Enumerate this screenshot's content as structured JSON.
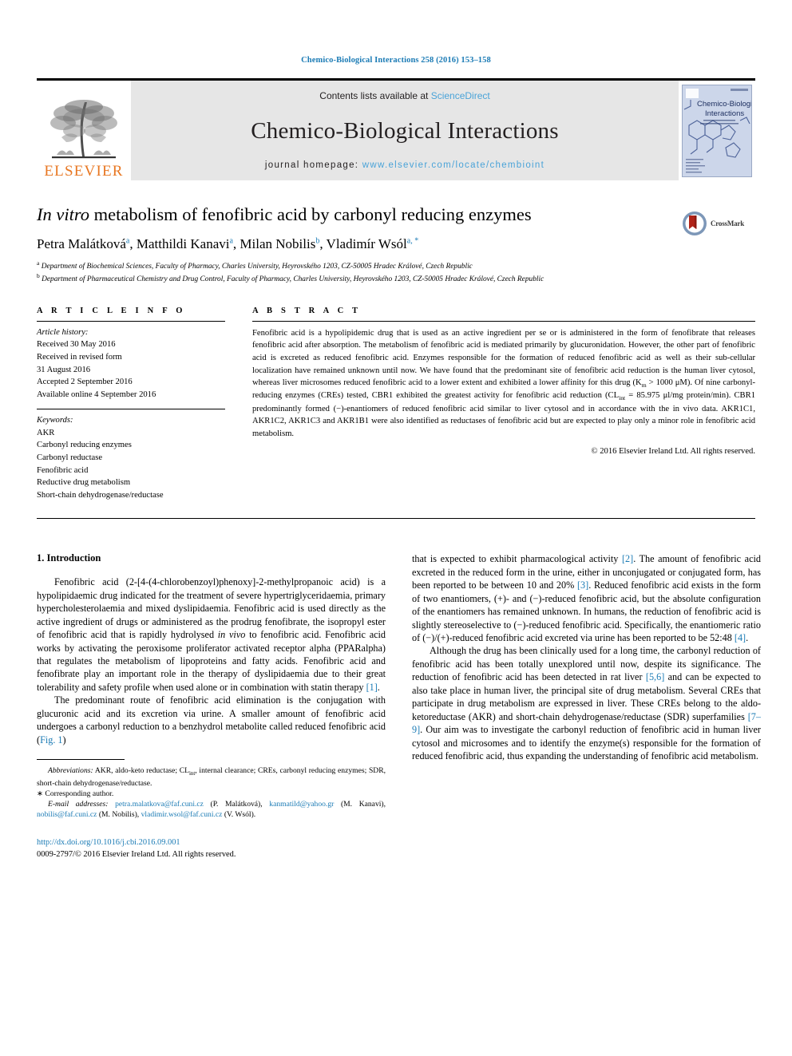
{
  "running_head": "Chemico-Biological Interactions 258 (2016) 153–158",
  "masthead": {
    "publisher_logo_name": "ELSEVIER",
    "contents_prefix": "Contents lists available at ",
    "contents_link": "ScienceDirect",
    "journal_title": "Chemico-Biological Interactions",
    "homepage_prefix": "journal homepage: ",
    "homepage_url": "www.elsevier.com/locate/chembioint",
    "cover_title_line1": "Chemico-Biological",
    "cover_title_line2": "Interactions"
  },
  "title": {
    "italic_lead": "In vitro",
    "rest": " metabolism of fenofibric acid by carbonyl reducing enzymes"
  },
  "crossmark": {
    "label": "CrossMark"
  },
  "authors": {
    "list": "Petra Malátková ᵃ, Matthildi Kanavi ᵃ, Milan Nobilis ᵇ, Vladimír Wsól ᵃ, *",
    "a1": "Petra Malátková",
    "a1_sup": "a",
    "a2": "Matthildi Kanavi",
    "a2_sup": "a",
    "a3": "Milan Nobilis",
    "a3_sup": "b",
    "a4": "Vladimír Wsól",
    "a4_sup": "a, *"
  },
  "affiliations": [
    {
      "marker": "a",
      "text": "Department of Biochemical Sciences, Faculty of Pharmacy, Charles University, Heyrovského 1203, CZ-50005 Hradec Králové, Czech Republic"
    },
    {
      "marker": "b",
      "text": "Department of Pharmaceutical Chemistry and Drug Control, Faculty of Pharmacy, Charles University, Heyrovského 1203, CZ-50005 Hradec Králové, Czech Republic"
    }
  ],
  "article_info": {
    "heading": "A R T I C L E   I N F O",
    "history_label": "Article history:",
    "history": [
      "Received 30 May 2016",
      "Received in revised form",
      "31 August 2016",
      "Accepted 2 September 2016",
      "Available online 4 September 2016"
    ],
    "keywords_label": "Keywords:",
    "keywords": [
      "AKR",
      "Carbonyl reducing enzymes",
      "Carbonyl reductase",
      "Fenofibric acid",
      "Reductive drug metabolism",
      "Short-chain dehydrogenase/reductase"
    ]
  },
  "abstract": {
    "heading": "A B S T R A C T",
    "text": "Fenofibric acid is a hypolipidemic drug that is used as an active ingredient per se or is administered in the form of fenofibrate that releases fenofibric acid after absorption. The metabolism of fenofibric acid is mediated primarily by glucuronidation. However, the other part of fenofibric acid is excreted as reduced fenofibric acid. Enzymes responsible for the formation of reduced fenofibric acid as well as their sub-cellular localization have remained unknown until now. We have found that the predominant site of fenofibric acid reduction is the human liver cytosol, whereas liver microsomes reduced fenofibric acid to a lower extent and exhibited a lower affinity for this drug (Km > 1000 μM). Of nine carbonyl-reducing enzymes (CREs) tested, CBR1 exhibited the greatest activity for fenofibric acid reduction (CLint = 85.975 μl/mg protein/min). CBR1 predominantly formed (−)-enantiomers of reduced fenofibric acid similar to liver cytosol and in accordance with the in vivo data. AKR1C1, AKR1C2, AKR1C3 and AKR1B1 were also identified as reductases of fenofibric acid but are expected to play only a minor role in fenofibric acid metabolism.",
    "copyright": "© 2016 Elsevier Ireland Ltd. All rights reserved."
  },
  "introduction": {
    "heading": "1. Introduction",
    "para1": "Fenofibric acid (2-[4-(4-chlorobenzoyl)phenoxy]-2-methylpropanoic acid) is a hypolipidaemic drug indicated for the treatment of severe hypertriglyceridaemia, primary hypercholesterolaemia and mixed dyslipidaemia. Fenofibric acid is used directly as the active ingredient of drugs or administered as the prodrug fenofibrate, the isopropyl ester of fenofibric acid that is rapidly hydrolysed in vivo to fenofibric acid. Fenofibric acid works by activating the peroxisome proliferator activated receptor alpha (PPARalpha) that regulates the metabolism of lipoproteins and fatty acids. Fenofibric acid and fenofibrate play an important role in the therapy of dyslipidaemia due to their great tolerability and safety profile when used alone or in combination with statin therapy [1].",
    "para2": "The predominant route of fenofibric acid elimination is the conjugation with glucuronic acid and its excretion via urine. A smaller amount of fenofibric acid undergoes a carbonyl reduction to a benzhydrol metabolite called reduced fenofibric acid (Fig. 1)",
    "para3": "that is expected to exhibit pharmacological activity [2]. The amount of fenofibric acid excreted in the reduced form in the urine, either in unconjugated or conjugated form, has been reported to be between 10 and 20% [3]. Reduced fenofibric acid exists in the form of two enantiomers, (+)- and (−)-reduced fenofibric acid, but the absolute configuration of the enantiomers has remained unknown. In humans, the reduction of fenofibric acid is slightly stereoselective to (−)-reduced fenofibric acid. Specifically, the enantiomeric ratio of (−)/(+)-reduced fenofibric acid excreted via urine has been reported to be 52:48 [4].",
    "para4": "Although the drug has been clinically used for a long time, the carbonyl reduction of fenofibric acid has been totally unexplored until now, despite its significance. The reduction of fenofibric acid has been detected in rat liver [5,6] and can be expected to also take place in human liver, the principal site of drug metabolism. Several CREs that participate in drug metabolism are expressed in liver. These CREs belong to the aldo-ketoreductase (AKR) and short-chain dehydrogenase/reductase (SDR) superfamilies [7–9]. Our aim was to investigate the carbonyl reduction of fenofibric acid in human liver cytosol and microsomes and to identify the enzyme(s) responsible for the formation of reduced fenofibric acid, thus expanding the understanding of fenofibric acid metabolism."
  },
  "footnotes": {
    "abbreviations_label": "Abbreviations:",
    "abbreviations_text": " AKR, aldo-keto reductase; CLint, internal clearance; CREs, carbonyl reducing enzymes; SDR, short-chain dehydrogenase/reductase.",
    "corresponding": "∗ Corresponding author.",
    "email_label": "E-mail addresses:",
    "emails": [
      {
        "mail": "petra.malatkova@faf.cuni.cz",
        "who": " (P. Malátková), "
      },
      {
        "mail": "kanmatild@yahoo.gr",
        "who": " (M. Kanavi), "
      },
      {
        "mail": "nobilis@faf.cuni.cz",
        "who": " (M. Nobilis), "
      },
      {
        "mail": "vladimir.wsol@faf.cuni.cz",
        "who": " (V. Wsól)."
      }
    ]
  },
  "doi": {
    "url": "http://dx.doi.org/10.1016/j.cbi.2016.09.001",
    "issn_line": "0009-2797/© 2016 Elsevier Ireland Ltd. All rights reserved."
  },
  "colors": {
    "link_blue": "#1b7bb5",
    "sciencedirect_blue": "#4aa3d8",
    "elsevier_orange": "#e87722",
    "band_gray": "#e6e6e6",
    "cover_blue": "#ccd6ea"
  }
}
